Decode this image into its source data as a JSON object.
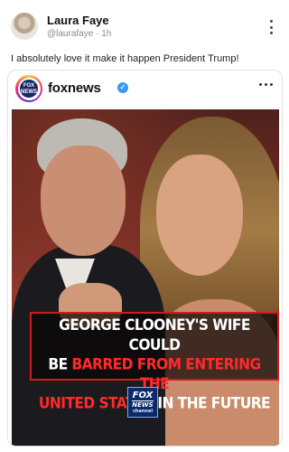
{
  "post": {
    "author_name": "Laura Faye",
    "author_handle": "@laurafaye",
    "separator": "·",
    "time_ago": "1h",
    "caption": "I absolutely love it make it happen President Trump!"
  },
  "embed": {
    "account_name": "foxnews",
    "verified_mark": "✓",
    "logo_text_line1": "FOX",
    "logo_text_line2": "NEWS",
    "headline_part1": "GEORGE CLOONEY'S WIFE COULD",
    "headline_part2a": "BE ",
    "headline_part2b": "BARRED FROM ENTERING THE",
    "headline_part3a": "UNITED STATES",
    "headline_part3b": " IN THE FUTURE",
    "badge_line1": "FOX",
    "badge_line2": "NEWS",
    "badge_line3": "channel"
  },
  "icons": {
    "avatar": "avatar",
    "more_options": "more-options-icon",
    "verified": "verified-icon"
  },
  "colors": {
    "headline_accent": "#ff2a2a",
    "banner_border": "#d21a1a",
    "verified_blue": "#3897f0"
  }
}
